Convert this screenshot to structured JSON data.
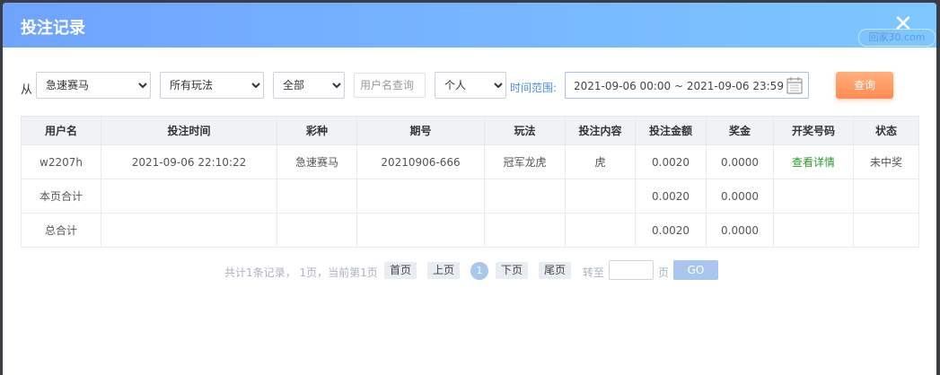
{
  "dialog": {
    "title": "投注记录",
    "close_icon": "close-icon",
    "watermark": "回家30.com"
  },
  "filters": {
    "from_label": "从",
    "lottery_select": "急速赛马",
    "play_select": "所有玩法",
    "status_select": "全部",
    "username_placeholder": "用户名查询",
    "scope_select": "个人",
    "range_label": "时间范围:",
    "date_range": "2021-09-06 00:00 ~ 2021-09-06 23:59",
    "calendar_icon": "calendar-icon",
    "query_button": "查询"
  },
  "table": {
    "headers": [
      "用户名",
      "投注时间",
      "彩种",
      "期号",
      "玩法",
      "投注内容",
      "投注金额",
      "奖金",
      "开奖号码",
      "状态"
    ],
    "rows": [
      [
        "w2207h",
        "2021-09-06 22:10:22",
        "急速赛马",
        "20210906-666",
        "冠军龙虎",
        "虎",
        "0.0020",
        "0.0000",
        "查看详情",
        "未中奖"
      ],
      [
        "本页合计",
        "",
        "",
        "",
        "",
        "",
        "0.0020",
        "0.0000",
        "",
        ""
      ],
      [
        "总合计",
        "",
        "",
        "",
        "",
        "",
        "0.0020",
        "0.0000",
        "",
        ""
      ]
    ]
  },
  "pagination": {
    "info": "共计1条记录， 1页，当前第1页",
    "first": "首页",
    "prev": "上页",
    "current": "1",
    "next": "下页",
    "last": "尾页",
    "goto_label": "转至",
    "page_label": "页",
    "go_button": "GO"
  }
}
